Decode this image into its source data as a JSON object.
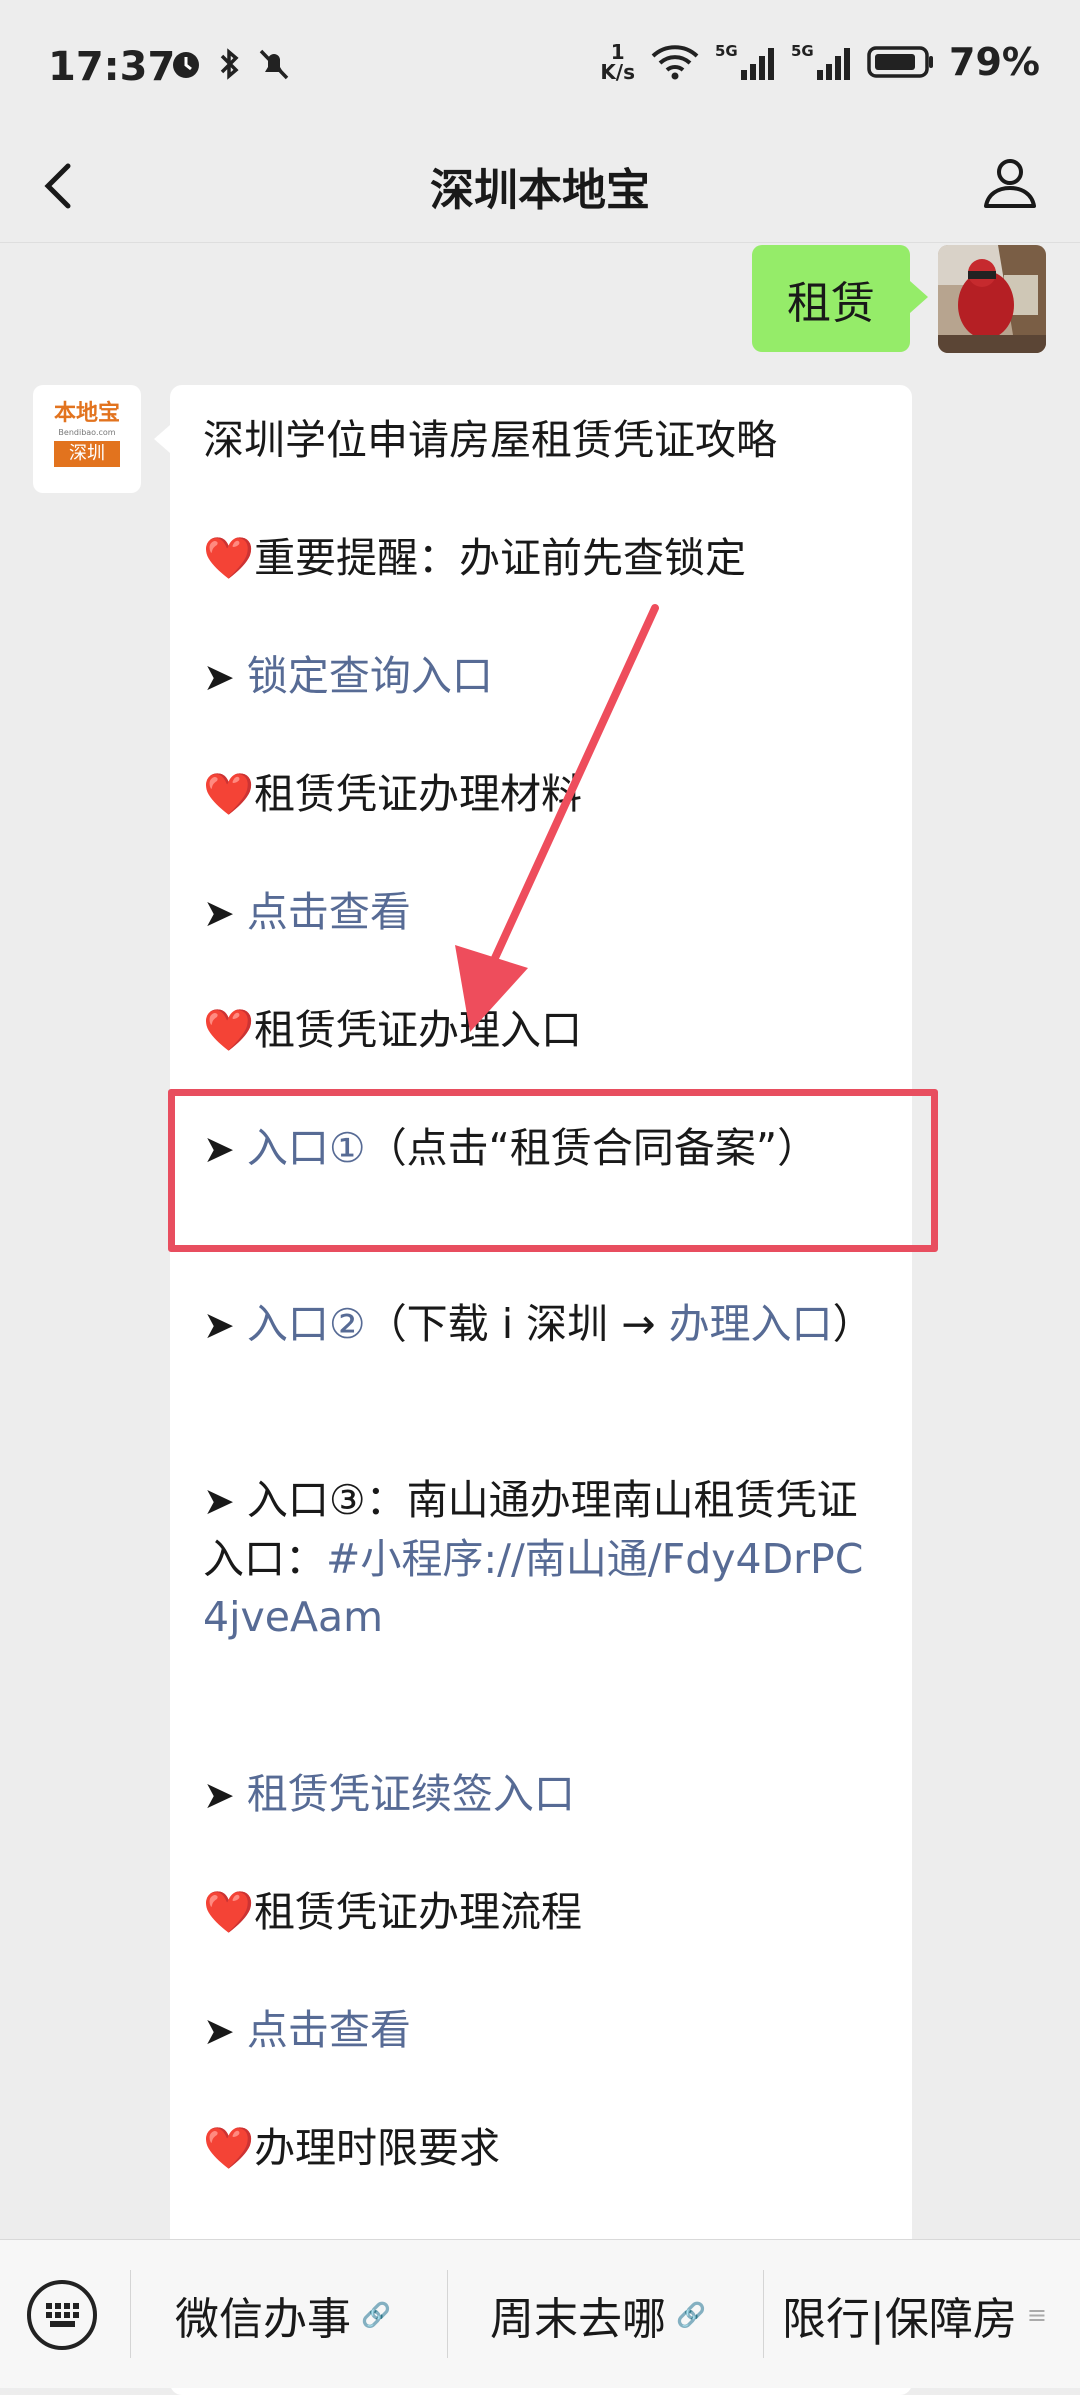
{
  "status": {
    "time": "17:37",
    "speed_num": "1",
    "speed_unit": "K/s",
    "battery": "79%"
  },
  "nav": {
    "title": "深圳本地宝"
  },
  "user_msg": {
    "text": "租赁"
  },
  "bot_logo": {
    "top": "本地宝",
    "mid": "Bendibao.com",
    "bottom": "深圳"
  },
  "message": {
    "l1": "深圳学位申请房屋租赁凭证攻略",
    "l2_heart": "❤️",
    "l2": "重要提醒：办证前先查锁定",
    "l3_arrow": "➤ ",
    "l3_link": "锁定查询入口",
    "l4_heart": "❤️",
    "l4": "租赁凭证办理材料",
    "l5_arrow": "➤ ",
    "l5_link": "点击查看",
    "l6_heart": "❤️",
    "l6": "租赁凭证办理入口",
    "l7_arrow": "➤ ",
    "l7_link": "入口①",
    "l7_rest": "（点击“租赁合同备案”）",
    "l8_arrow": "➤ ",
    "l8_link": "入口②",
    "l8_mid": "（下载 i 深圳 → ",
    "l8_link2": "办理入口",
    "l8_end": "）",
    "l9_arrow": "➤ ",
    "l9": "入口③：南山通办理南山租赁凭证入口：",
    "l9_link": "#小程序://南山通/Fdy4DrPC4jveAam",
    "l10_arrow": "➤ ",
    "l10_link": "租赁凭证续签入口",
    "l11_heart": "❤️",
    "l11": "租赁凭证办理流程",
    "l12_arrow": "➤ ",
    "l12_link": "点击查看",
    "l13_heart": "❤️",
    "l13": "办理时限要求"
  },
  "bottom_menu": {
    "item1": "微信办事",
    "item2": "周末去哪",
    "item3": "限行|保障房"
  }
}
